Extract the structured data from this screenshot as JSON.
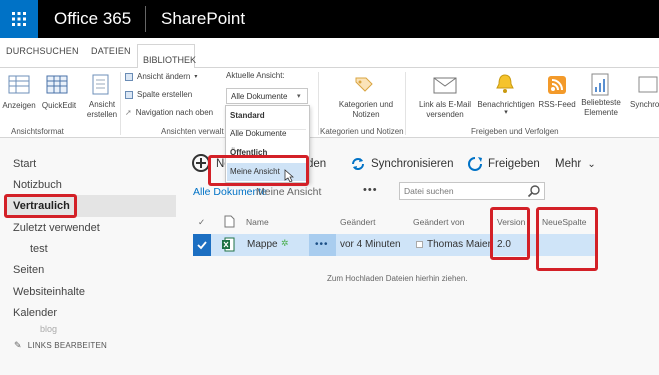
{
  "suitebar": {
    "app": "Office 365",
    "site": "SharePoint"
  },
  "ribbon_tabs": [
    "DURCHSUCHEN",
    "DATEIEN",
    "BIBLIOTHEK"
  ],
  "ribbon": {
    "buttons": {
      "anzeigen": "Anzeigen",
      "quickedit": "QuickEdit",
      "ansicht_erstellen": "Ansicht erstellen",
      "ansicht_aendern": "Ansicht ändern",
      "spalte_erstellen": "Spalte erstellen",
      "navigation_nach_oben": "Navigation nach oben",
      "kategorien": "Kategorien und Notizen",
      "link_email": "Link als E-Mail versenden",
      "benachrichtigen": "Benachrichtigen",
      "rss": "RSS-Feed",
      "beliebteste": "Beliebteste Elemente",
      "synchron": "Synchro"
    },
    "groups": {
      "ansichtsformat": "Ansichtsformat",
      "ansichten": "Ansichten verwalt",
      "kategorien": "Kategorien und Notizen",
      "freigeben": "Freigeben und Verfolgen"
    },
    "view_select": {
      "caption": "Aktuelle Ansicht:",
      "value": "Alle Dokumente",
      "dropdown": {
        "header_standard": "Standard",
        "alle": "Alle Dokumente",
        "header_oeffentlich": "Öffentlich",
        "meine": "Meine Ansicht"
      }
    }
  },
  "nav": {
    "items": [
      "Start",
      "Notizbuch",
      "Vertraulich",
      "Zuletzt verwendet",
      "test",
      "Seiten",
      "Websiteinhalte",
      "Kalender"
    ],
    "blog": "blog",
    "edit": "LINKS BEARBEITEN"
  },
  "commands": {
    "new_partial": "Ne",
    "upload_partial": "den",
    "sync": "Synchronisieren",
    "share": "Freigeben",
    "more": "Mehr"
  },
  "views": {
    "all": "Alle Dokumente",
    "mine": "Meine Ansicht",
    "more": "•••"
  },
  "search": {
    "placeholder": "Datei suchen"
  },
  "table": {
    "headers": {
      "name": "Name",
      "modified": "Geändert",
      "modified_by": "Geändert von",
      "version": "Version",
      "new_column": "NeueSpalte"
    },
    "rows": [
      {
        "name": "Mappe",
        "dots": "•••",
        "modified": "vor 4 Minuten",
        "modified_by": "Thomas Maier",
        "version": "2.0",
        "new_column": ""
      }
    ]
  },
  "upload_hint": "Zum Hochladen Dateien hierhin ziehen.",
  "colors": {
    "accent": "#0072c6",
    "highlight": "#d32027",
    "selected_row": "#cfe4f8"
  }
}
